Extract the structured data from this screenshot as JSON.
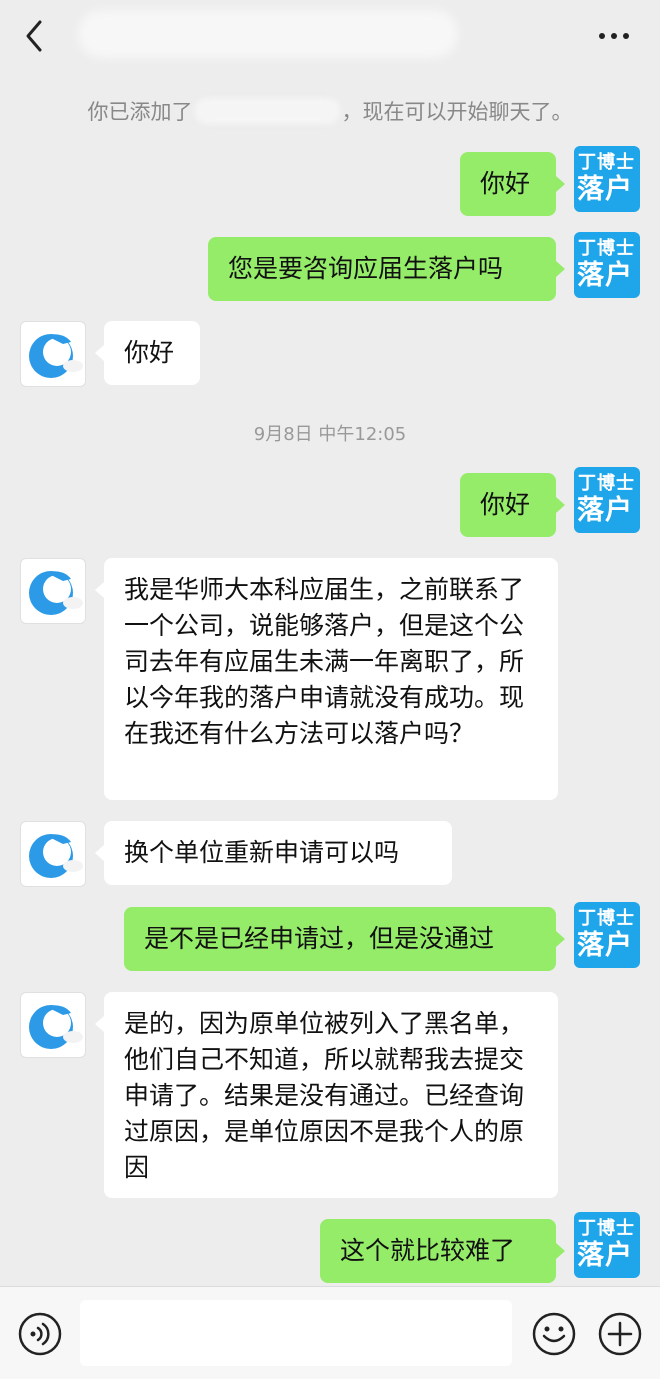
{
  "header": {
    "back_icon": "chevron-left-icon",
    "more_icon": "more-dots-icon"
  },
  "system_notice": {
    "prefix": "你已添加了",
    "suffix": "，现在可以开始聊天了。"
  },
  "timestamp": "9月8日 中午12:05",
  "self_avatar": {
    "line1": "丁博士",
    "line2": "落户",
    "color": "#1ea5ea"
  },
  "messages": [
    {
      "side": "right",
      "text": "你好"
    },
    {
      "side": "right",
      "text": "您是要咨询应届生落户吗"
    },
    {
      "side": "left",
      "text": "你好"
    },
    {
      "side": "right",
      "text": "你好"
    },
    {
      "side": "left",
      "text": "我是华师大本科应届生，之前联系了一个公司，说能够落户，但是这个公司去年有应届生未满一年离职了，所以今年我的落户申请就没有成功。现在我还有什么方法可以落户吗？"
    },
    {
      "side": "left",
      "text": "换个单位重新申请可以吗"
    },
    {
      "side": "right",
      "text": "是不是已经申请过，但是没通过"
    },
    {
      "side": "left",
      "text": "是的，因为原单位被列入了黑名单，他们自己不知道，所以就帮我去提交申请了。结果是没有通过。已经查询过原因，是单位原因不是我个人的原因"
    },
    {
      "side": "right",
      "text": "这个就比较难了"
    }
  ],
  "bottom_bar": {
    "voice_icon": "voice-icon",
    "emoji_icon": "emoji-icon",
    "plus_icon": "plus-icon",
    "input_placeholder": ""
  },
  "colors": {
    "self_bubble": "#95ec69",
    "other_bubble": "#ffffff",
    "background": "#ededed"
  }
}
